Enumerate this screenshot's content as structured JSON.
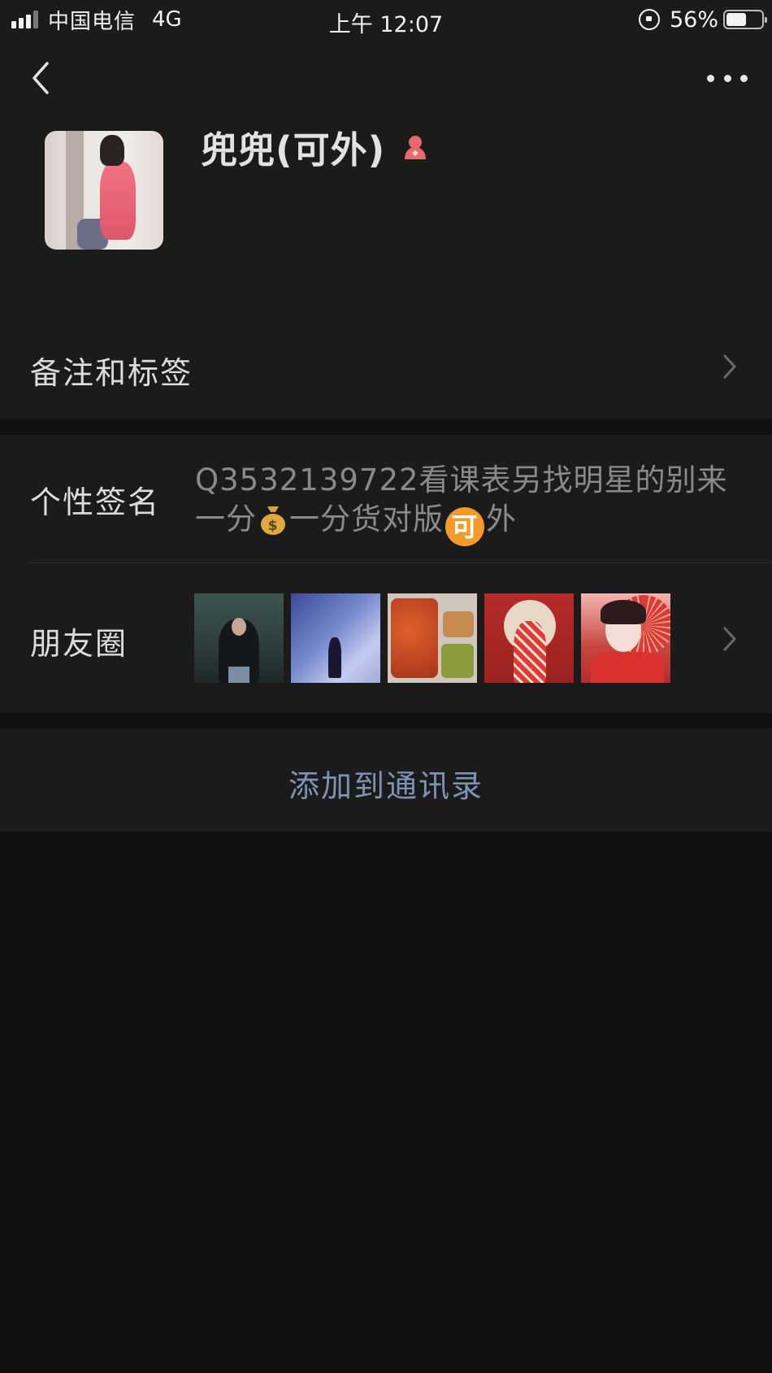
{
  "status_bar": {
    "carrier": "中国电信",
    "network": "4G",
    "time": "上午 12:07",
    "battery_percent": "56%",
    "battery_level": 0.56
  },
  "nav": {
    "back_icon": "chevron-left-icon",
    "more_icon": "more-dots-icon"
  },
  "profile": {
    "name": "兜兜(可外)",
    "gender_icon": "female-icon",
    "gender_color": "#e8696b"
  },
  "remark_row": {
    "label": "备注和标签"
  },
  "signature_row": {
    "label": "个性签名",
    "text_part1": "Q3532139722看课表另找明星的别来一分",
    "text_part2": "一分货对版",
    "emoji_badge": "可",
    "text_part3": "外"
  },
  "moments_row": {
    "label": "朋友圈",
    "thumbnail_count": 5
  },
  "add_contact": {
    "label": "添加到通讯录",
    "color": "#7d93b4"
  },
  "colors": {
    "background": "#111111",
    "section": "#1b1b1b",
    "primary_text": "#dcdcdc",
    "secondary_text": "#8a8a8a"
  }
}
